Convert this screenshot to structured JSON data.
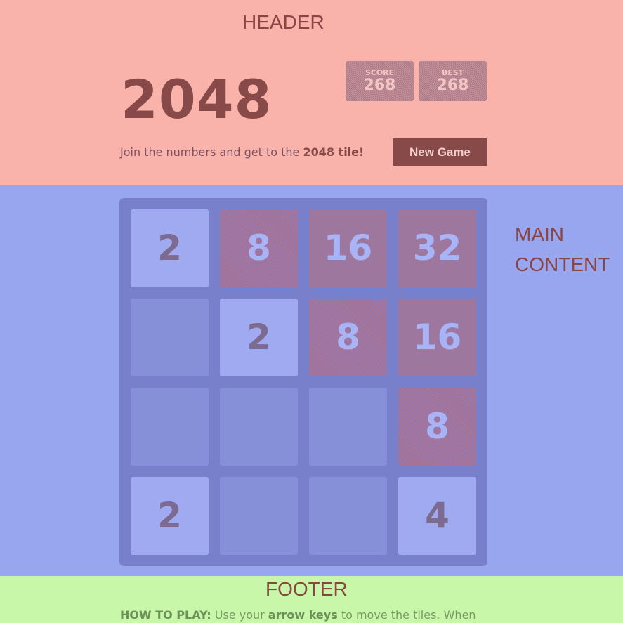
{
  "annotations": {
    "header": "HEADER",
    "main": "MAIN CONTENT",
    "main_line1": "MAIN",
    "main_line2": "CONTENT",
    "footer": "FOOTER"
  },
  "colors": {
    "header_overlay": "#f9b3ab",
    "main_overlay": "#98a5ef",
    "footer_overlay": "#c8f7aa",
    "button": "#874a48"
  },
  "header": {
    "title": "2048",
    "score_label": "SCORE",
    "score_value": "268",
    "best_label": "BEST",
    "best_value": "268",
    "intro_text": "Join the numbers and get to the ",
    "intro_bold": "2048 tile!",
    "new_game_label": "New Game"
  },
  "board": {
    "rows": [
      [
        "2",
        "8",
        "16",
        "32"
      ],
      [
        "",
        "2",
        "8",
        "16"
      ],
      [
        "",
        "",
        "",
        "8"
      ],
      [
        "2",
        "",
        "",
        "4"
      ]
    ]
  },
  "footer": {
    "howto_label": "HOW TO PLAY:",
    "text1": " Use your ",
    "bold": "arrow keys",
    "text2": " to move the tiles. When"
  }
}
